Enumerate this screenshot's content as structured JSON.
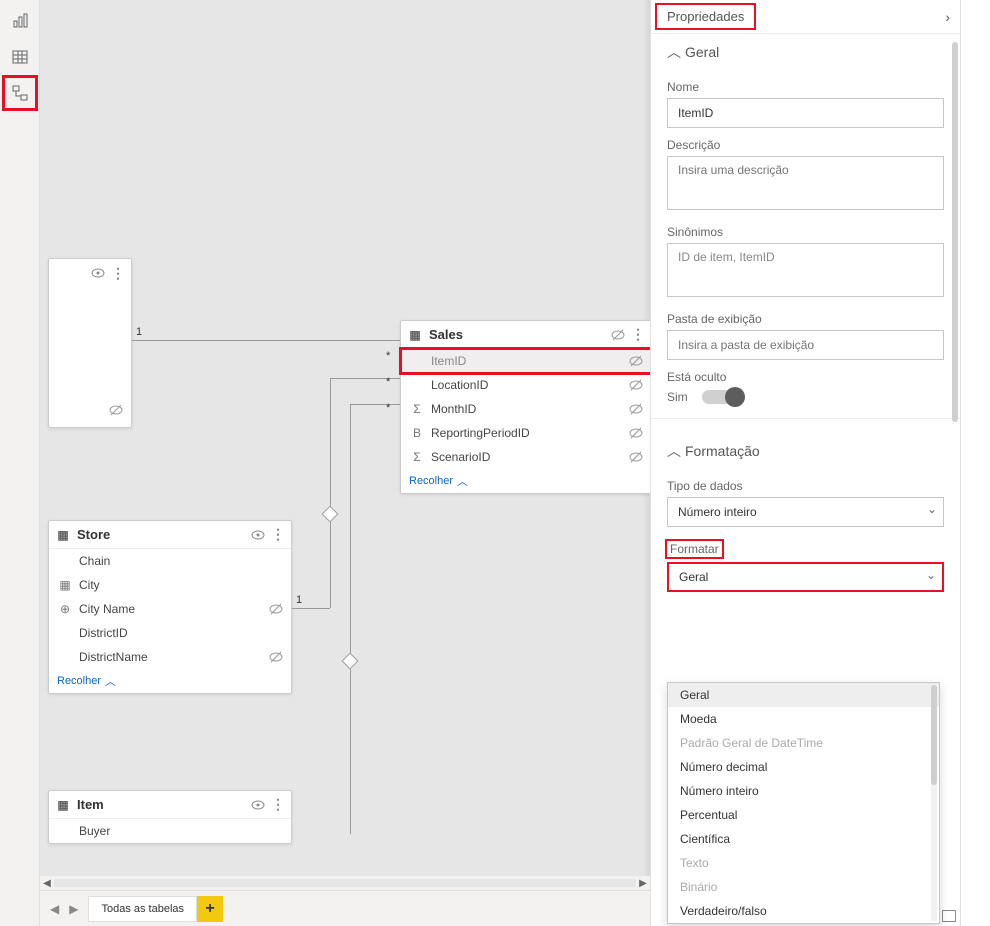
{
  "rail": {
    "report": "report-icon",
    "data": "data-icon",
    "model": "model-icon"
  },
  "props_title": "Propriedades",
  "sections": {
    "general": "Geral",
    "formatting": "Formatação"
  },
  "labels": {
    "name": "Nome",
    "desc": "Descrição",
    "syn": "Sinônimos",
    "folder": "Pasta de exibição",
    "hidden": "Está oculto",
    "hidden_yes": "Sim",
    "datatype": "Tipo de dados",
    "format": "Formatar"
  },
  "values": {
    "name": "ItemID",
    "desc_ph": "Insira uma descrição",
    "syn": "ID de item, ItemID",
    "folder_ph": "Insira a pasta de exibição",
    "datatype": "Número inteiro",
    "format": "Geral"
  },
  "format_options": [
    {
      "label": "Geral",
      "disabled": false,
      "selected": true
    },
    {
      "label": "Moeda",
      "disabled": false
    },
    {
      "label": "Padrão Geral de DateTime",
      "disabled": true
    },
    {
      "label": "Número decimal",
      "disabled": false
    },
    {
      "label": "Número inteiro",
      "disabled": false
    },
    {
      "label": "Percentual",
      "disabled": false
    },
    {
      "label": "Científica",
      "disabled": false
    },
    {
      "label": "Texto",
      "disabled": true
    },
    {
      "label": "Binário",
      "disabled": true
    },
    {
      "label": "Verdadeiro/falso",
      "disabled": false
    }
  ],
  "tables": {
    "date": {
      "name": "",
      "fields": []
    },
    "sales": {
      "name": "Sales",
      "fields": [
        {
          "name": "ItemID",
          "hidden": true,
          "selected": true
        },
        {
          "name": "LocationID",
          "hidden": true
        },
        {
          "name": "MonthID",
          "hidden": true,
          "icon": "Σ"
        },
        {
          "name": "ReportingPeriodID",
          "hidden": true,
          "icon": "B"
        },
        {
          "name": "ScenarioID",
          "hidden": true,
          "icon": "Σ"
        }
      ],
      "collapse": "Recolher"
    },
    "store": {
      "name": "Store",
      "fields": [
        {
          "name": "Chain"
        },
        {
          "name": "City",
          "icon": "▦"
        },
        {
          "name": "City Name",
          "icon": "⊕",
          "hidden": true
        },
        {
          "name": "DistrictID"
        },
        {
          "name": "DistrictName",
          "hidden": true
        }
      ],
      "collapse": "Recolher"
    },
    "item": {
      "name": "Item",
      "fields": [
        {
          "name": "Buyer"
        }
      ]
    }
  },
  "rel": {
    "one": "1",
    "many": "*"
  },
  "tabs": {
    "all": "Todas as tabelas"
  }
}
